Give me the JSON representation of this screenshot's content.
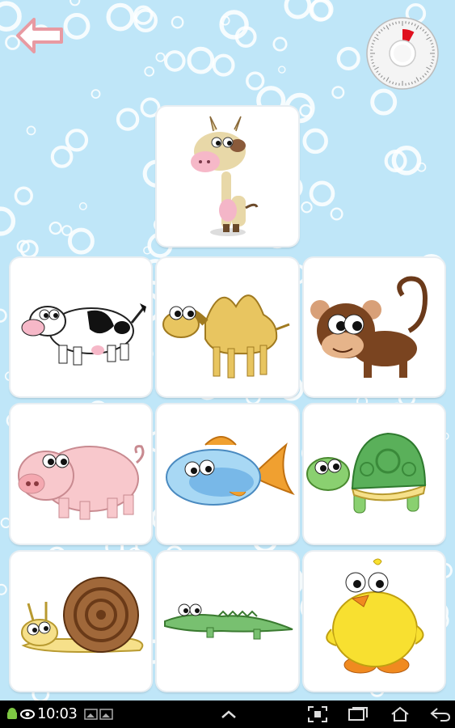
{
  "screen": {
    "background": "#bfe6f8",
    "bubble_color": "#ffffff"
  },
  "header": {
    "back_button": {
      "icon": "arrow-left-icon",
      "color": "#e89aa2"
    },
    "timer": {
      "icon": "countdown-timer-icon",
      "remaining_fraction": 0.92,
      "elapsed_color": "#e0101e"
    }
  },
  "target": {
    "animal": "giraffe",
    "icon": "giraffe-icon"
  },
  "choices": [
    {
      "animal": "cow",
      "icon": "cow-icon"
    },
    {
      "animal": "camel",
      "icon": "camel-icon"
    },
    {
      "animal": "monkey",
      "icon": "monkey-icon"
    },
    {
      "animal": "pig",
      "icon": "pig-icon"
    },
    {
      "animal": "fish",
      "icon": "fish-icon"
    },
    {
      "animal": "turtle",
      "icon": "turtle-icon"
    },
    {
      "animal": "snail",
      "icon": "snail-icon"
    },
    {
      "animal": "crocodile",
      "icon": "crocodile-icon"
    },
    {
      "animal": "chick",
      "icon": "chick-icon"
    }
  ],
  "status_bar": {
    "time": "10:03",
    "icons": [
      "android-icon",
      "eye-icon",
      "gallery-icon"
    ],
    "nav": [
      "up-icon",
      "screenshot-icon",
      "recent-apps-icon",
      "home-icon",
      "back-icon"
    ]
  }
}
